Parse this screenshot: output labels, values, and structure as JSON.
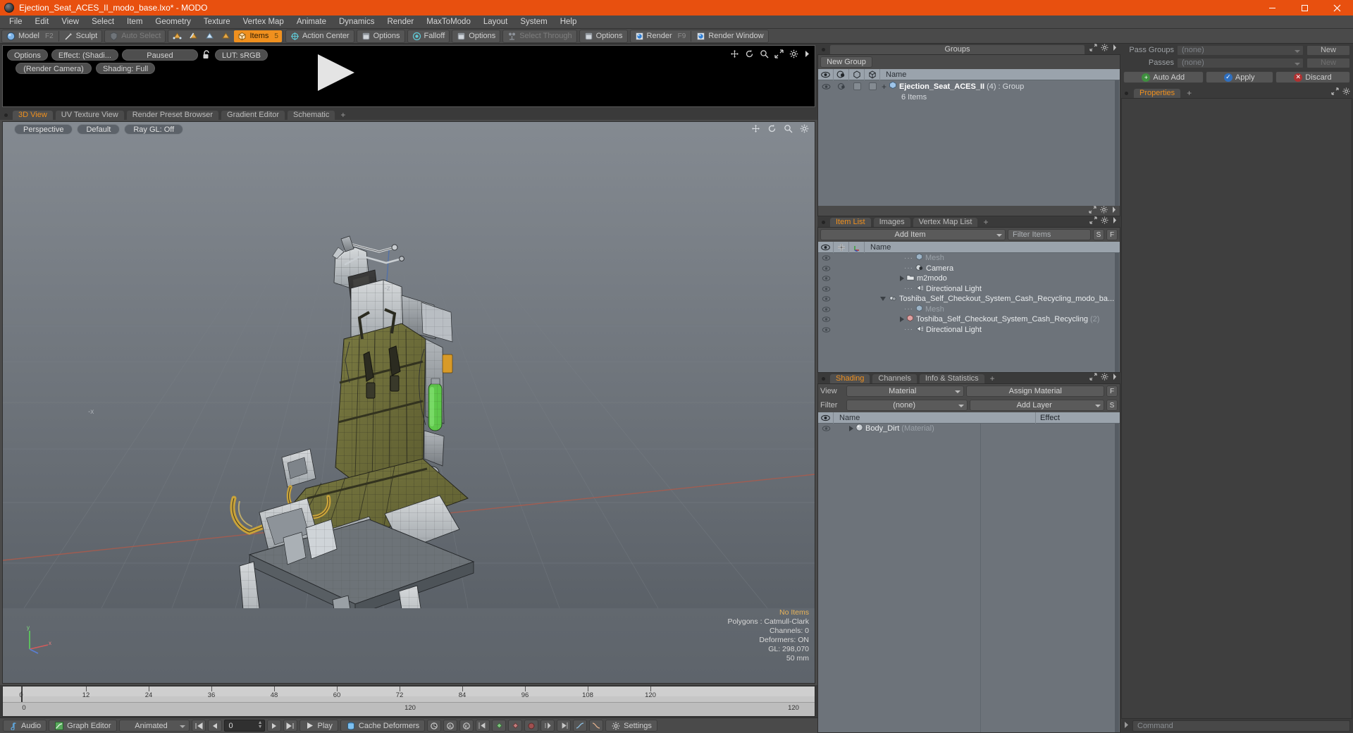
{
  "window": {
    "title": "Ejection_Seat_ACES_II_modo_base.lxo* - MODO",
    "minimize": "minimize-button",
    "maximize": "maximize-button",
    "close": "close-button"
  },
  "menubar": {
    "items": [
      "File",
      "Edit",
      "View",
      "Select",
      "Item",
      "Geometry",
      "Texture",
      "Vertex Map",
      "Animate",
      "Dynamics",
      "Render",
      "MaxToModo",
      "Layout",
      "System",
      "Help"
    ]
  },
  "toolbar": {
    "mode_model": "Model",
    "mode_model_hotkey": "F2",
    "mode_sculpt": "Sculpt",
    "auto_select": "Auto Select",
    "items": "Items",
    "items_hotkey": "5",
    "action_center": "Action Center",
    "options_1": "Options",
    "falloff": "Falloff",
    "options_2": "Options",
    "select_through": "Select Through",
    "options_3": "Options",
    "render": "Render",
    "render_hotkey": "F9",
    "render_window": "Render Window"
  },
  "preview": {
    "options": "Options",
    "effect": "Effect: (Shadi...",
    "state": "Paused",
    "lut": "LUT: sRGB",
    "camera": "(Render Camera)",
    "shading": "Shading: Full"
  },
  "viewport_tabs": {
    "tabs": [
      "3D View",
      "UV Texture View",
      "Render Preset Browser",
      "Gradient Editor",
      "Schematic"
    ],
    "active": "3D View",
    "add": "+"
  },
  "viewport": {
    "projection": "Perspective",
    "style": "Default",
    "raygl": "Ray GL: Off",
    "axis_z": "-z",
    "axis_x": "-x",
    "axis_y_gizmo": "y",
    "axis_x_gizmo": "x",
    "stats": {
      "selection": "No Items",
      "polygons": "Polygons : Catmull-Clark",
      "channels": "Channels: 0",
      "deformers": "Deformers: ON",
      "gl": "GL: 298,070",
      "scale": "50 mm"
    }
  },
  "timeline": {
    "top_ticks": [
      0,
      12,
      24,
      36,
      48,
      60,
      72,
      84,
      96,
      108,
      120
    ],
    "bottom_left": "0",
    "bottom_center": "120",
    "bottom_right": "120"
  },
  "transport": {
    "audio": "Audio",
    "graph_editor": "Graph Editor",
    "animated": "Animated",
    "frame_value": "0",
    "play": "Play",
    "cache_deformers": "Cache Deformers",
    "settings": "Settings"
  },
  "groups_panel": {
    "title": "Groups",
    "new_group_button": "New Group",
    "column_name": "Name",
    "rows": [
      {
        "name": "Ejection_Seat_ACES_II",
        "count": "(4)",
        "type": ": Group",
        "sub": "6 Items"
      }
    ]
  },
  "item_list_panel": {
    "tabs": [
      "Item List",
      "Images",
      "Vertex Map List"
    ],
    "active_tab": "Item List",
    "add_tab": "+",
    "add_item_button": "Add Item",
    "filter_placeholder": "Filter Items",
    "btn_s": "S",
    "btn_f": "F",
    "column_name": "Name",
    "rows": [
      {
        "label": "Mesh",
        "indent": 1,
        "dim": true,
        "icon": "mesh-icon",
        "expander": "none"
      },
      {
        "label": "Camera",
        "indent": 1,
        "dim": false,
        "icon": "camera-icon",
        "expander": "none"
      },
      {
        "label": "m2modo",
        "indent": 1,
        "dim": false,
        "icon": "folder-icon",
        "expander": "right"
      },
      {
        "label": "Directional Light",
        "indent": 1,
        "dim": false,
        "icon": "light-icon",
        "expander": "none"
      },
      {
        "label": "Toshiba_Self_Checkout_System_Cash_Recycling_modo_ba...",
        "indent": 0,
        "dim": false,
        "icon": "assembly-icon",
        "expander": "down"
      },
      {
        "label": "Mesh",
        "indent": 2,
        "dim": true,
        "icon": "mesh-icon",
        "expander": "none"
      },
      {
        "label": "Toshiba_Self_Checkout_System_Cash_Recycling",
        "suffix": "(2)",
        "indent": 2,
        "dim": false,
        "icon": "group-icon",
        "expander": "right"
      },
      {
        "label": "Directional Light",
        "indent": 2,
        "dim": false,
        "icon": "light-icon",
        "expander": "none"
      }
    ]
  },
  "shading_panel": {
    "tabs": [
      "Shading",
      "Channels",
      "Info & Statistics"
    ],
    "active_tab": "Shading",
    "add_tab": "+",
    "view_label": "View",
    "view_value": "Material",
    "assign_material": "Assign Material",
    "btn_f": "F",
    "filter_label": "Filter",
    "filter_value": "(none)",
    "add_layer": "Add Layer",
    "btn_s": "S",
    "column_name": "Name",
    "column_effect": "Effect",
    "rows": [
      {
        "name": "Body_Dirt",
        "type": "(Material)"
      }
    ]
  },
  "right_sidebar": {
    "pass_groups_label": "Pass Groups",
    "pass_groups_value": "(none)",
    "pass_groups_new": "New",
    "passes_label": "Passes",
    "passes_value": "(none)",
    "passes_new": "New",
    "auto_add": "Auto Add",
    "apply": "Apply",
    "discard": "Discard",
    "properties_tab": "Properties",
    "properties_add": "+",
    "command_placeholder": "Command"
  },
  "colors": {
    "accent": "#f0901e",
    "titlebar": "#e8500f",
    "panel_bg": "#4a4a4a",
    "list_bg": "#6d737a",
    "list_header": "#9aa3ac"
  }
}
